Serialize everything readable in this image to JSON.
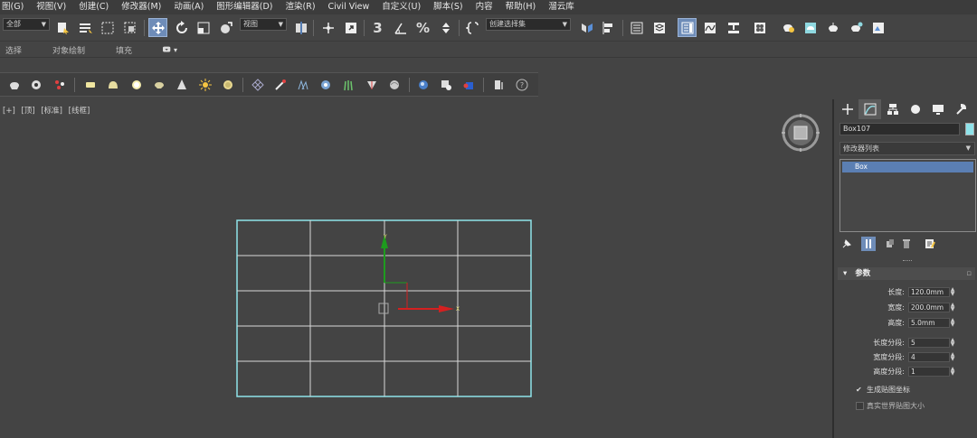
{
  "menu": [
    "图(G)",
    "视图(V)",
    "创建(C)",
    "修改器(M)",
    "动画(A)",
    "图形编辑器(D)",
    "渲染(R)",
    "Civil View",
    "自定义(U)",
    "脚本(S)",
    "内容",
    "帮助(H)",
    "溜云库"
  ],
  "toolbar": {
    "selection_filter": "全部",
    "ref_coord": "视图",
    "named_selection": "创建选择集",
    "snap_label": "3"
  },
  "ribbon": {
    "tabs": [
      "选择",
      "对象绘制",
      "填充"
    ]
  },
  "viewport": {
    "labels": [
      "[+]",
      "[顶]",
      "[标准]",
      "[线框]"
    ],
    "gizmo_y": "Y",
    "gizmo_x": "X"
  },
  "command_panel": {
    "object_name": "Box107",
    "object_color": "#8fe3ea",
    "modifier_list": "修改器列表",
    "stack_item": "Box"
  },
  "params": {
    "title": "参数",
    "length_label": "长度:",
    "length": "120.0mm",
    "width_label": "宽度:",
    "width": "200.0mm",
    "height_label": "高度:",
    "height": "5.0mm",
    "lseg_label": "长度分段:",
    "lseg": "5",
    "wseg_label": "宽度分段:",
    "wseg": "4",
    "hseg_label": "高度分段:",
    "hseg": "1",
    "gen_uv": "生成贴图坐标",
    "gen_uv_checked": true,
    "real_world": "真实世界贴图大小",
    "real_world_checked": false
  },
  "colors": {
    "accent": "#6e8cb8",
    "selection": "#8fe3ea",
    "x_axis": "#d42020",
    "y_axis": "#1e9b1e"
  }
}
